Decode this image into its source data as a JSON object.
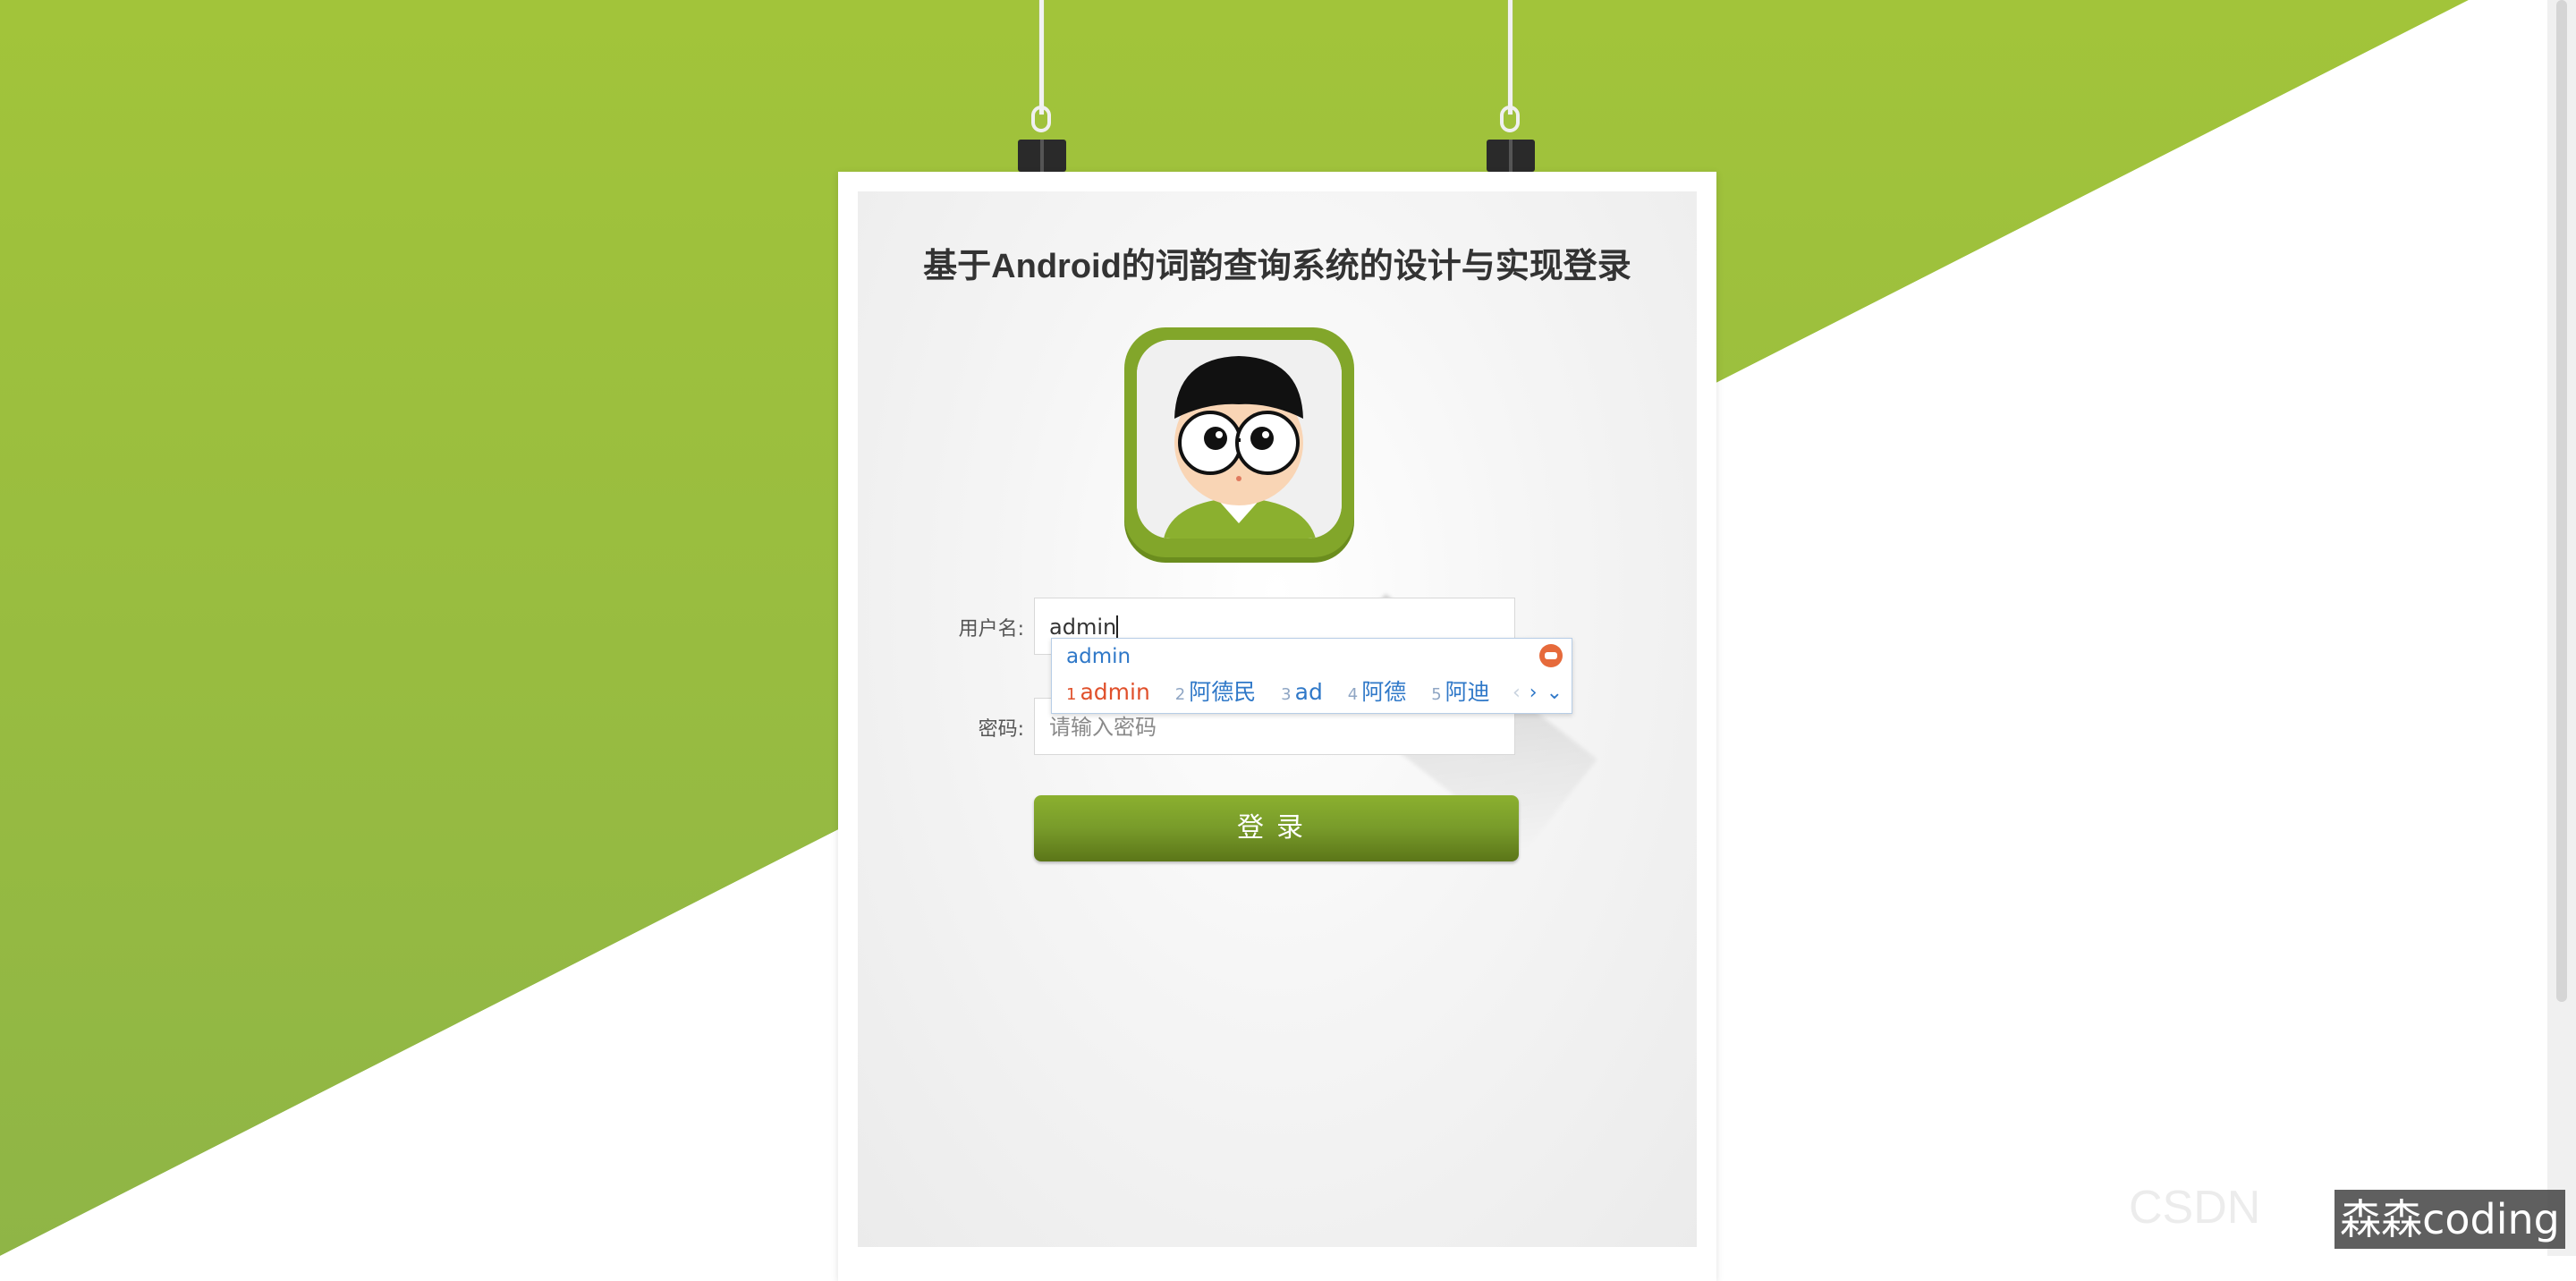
{
  "page": {
    "title": "基于Android的词韵查询系统的设计与实现登录",
    "brand_color": "#8fb536"
  },
  "form": {
    "username_label": "用户名:",
    "username_value": "admin",
    "password_label": "密码:",
    "password_placeholder": "请输入密码",
    "submit_label": "登录"
  },
  "ime": {
    "composition": "admin",
    "candidates": [
      {
        "num": "1",
        "text": "admin"
      },
      {
        "num": "2",
        "text": "阿德民"
      },
      {
        "num": "3",
        "text": "ad"
      },
      {
        "num": "4",
        "text": "阿德"
      },
      {
        "num": "5",
        "text": "阿迪"
      }
    ],
    "nav": {
      "prev": "‹",
      "next": "›",
      "expand": "⌄"
    }
  },
  "watermark": {
    "faint_text": "CSDN",
    "tag_text": "森森coding"
  }
}
